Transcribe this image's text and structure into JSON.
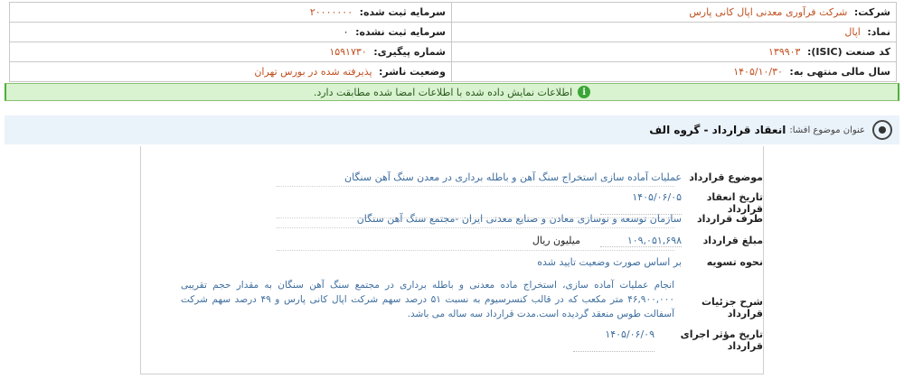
{
  "company_info": {
    "company_label": "شرکت:",
    "company_value": "شرکت فرآوری معدنی اپال کانی پارس",
    "registered_capital_label": "سرمایه ثبت شده:",
    "registered_capital_value": "۲۰۰۰۰۰۰۰",
    "symbol_label": "نماد:",
    "symbol_value": "اپال",
    "unregistered_capital_label": "سرمایه ثبت نشده:",
    "unregistered_capital_value": "۰",
    "isic_label": "کد صنعت (ISIC):",
    "isic_value": "۱۳۹۹۰۳",
    "tracking_label": "شماره پیگیری:",
    "tracking_value": "۱۵۹۱۷۳۰",
    "fiscal_year_label": "سال مالی منتهی به:",
    "fiscal_year_value": "۱۴۰۵/۱۰/۳۰",
    "publisher_status_label": "وضعیت ناشر:",
    "publisher_status_value": "پذیرفته شده در بورس تهران"
  },
  "alert": {
    "icon": "info-icon",
    "text": "اطلاعات نمایش داده شده با اطلاعات امضا شده مطابقت دارد."
  },
  "subject": {
    "label": "عنوان موضوع افشا:",
    "title": "انعقاد قرارداد - گروه الف"
  },
  "contract": {
    "subject_label": "موضوع قرارداد",
    "subject_value": "عملیات آماده سازی استخراج سنگ آهن و باطله برداری در معدن سنگ آهن سنگان",
    "date_label": "تاریخ انعقاد قرارداد",
    "date_value": "۱۴۰۵/۰۶/۰۵",
    "party_label": "طرف قرارداد",
    "party_value": "سازمان توسعه و نوسازی معادن و صنایع معدنی ایران -مجتمع سنگ آهن سنگان",
    "amount_label": "مبلغ قرارداد",
    "amount_value": "۱۰۹,۰۵۱,۶۹۸",
    "amount_unit": "میلیون ریال",
    "settlement_label": "نحوه تسویه",
    "settlement_value": "بر اساس صورت وضعیت تایید شده",
    "details_label": "شرح جزئیات قرارداد",
    "details_value": "انجام عملیات آماده سازی، استخراج ماده معدنی و باطله برداری در مجتمع سنگ آهن سنگان به مقدار حجم تقریبی ۴۶,۹۰۰,۰۰۰ متر مکعب که در قالب کنسرسیوم به نسبت ۵۱ درصد سهم شرکت اپال کانی پارس و ۴۹ درصد سهم شرکت آسفالت طوس منعقد گردیده است.مدت قرارداد سه ساله می باشد.",
    "effective_date_label": "تاریخ مؤثر اجرای قرارداد",
    "effective_date_value": "۱۴۰۵/۰۶/۰۹"
  }
}
